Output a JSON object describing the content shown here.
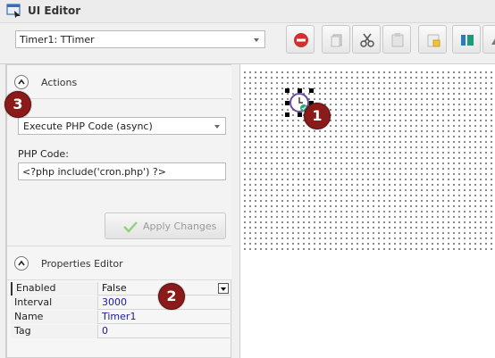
{
  "window": {
    "title": "UI Editor",
    "icon": "app-window-icon"
  },
  "toolbar": {
    "component_select": "Timer1: TTimer",
    "buttons": [
      {
        "icon": "delete-icon"
      },
      {
        "icon": "copy-icon"
      },
      {
        "icon": "cut-icon"
      },
      {
        "icon": "paste-icon"
      },
      {
        "icon": "paste-special-icon"
      },
      {
        "icon": "align-icon"
      },
      {
        "icon": "more-icon"
      }
    ]
  },
  "actions": {
    "title": "Actions",
    "selected_action": "Execute PHP Code (async)",
    "code_label": "PHP Code:",
    "code_value": "<?php include('cron.php') ?>",
    "apply_label": "Apply Changes"
  },
  "properties": {
    "title": "Properties Editor",
    "rows": [
      {
        "name": "Enabled",
        "value": "False"
      },
      {
        "name": "Interval",
        "value": "3000"
      },
      {
        "name": "Name",
        "value": "Timer1"
      },
      {
        "name": "Tag",
        "value": "0"
      }
    ]
  },
  "designer": {
    "component_icon": "timer-icon"
  },
  "badges": [
    "1",
    "2",
    "3"
  ],
  "colors": {
    "badge": "#8b1a1a",
    "delete_button": "#d32f2f",
    "property_value": "#1a1aa0"
  }
}
